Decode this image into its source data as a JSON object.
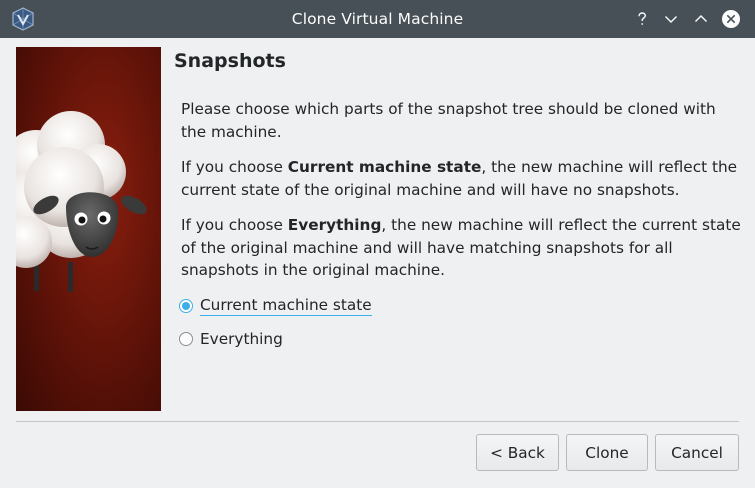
{
  "window": {
    "title": "Clone Virtual Machine",
    "controls": [
      "help-icon",
      "minimize-icon",
      "maximize-icon",
      "close-icon"
    ]
  },
  "page": {
    "title": "Snapshots",
    "paragraph1": "Please choose which parts of the snapshot tree should be cloned with the machine.",
    "paragraph2": {
      "prefix": "If you choose ",
      "bold": "Current machine state",
      "suffix": ", the new machine will reflect the current state of the original machine and will have no snapshots."
    },
    "paragraph3": {
      "prefix": "If you choose ",
      "bold": "Everything",
      "suffix": ", the new machine will reflect the current state of the original machine and will have matching snapshots for all snapshots in the original machine."
    }
  },
  "options": {
    "current": {
      "label": "Current machine state",
      "checked": true
    },
    "everything": {
      "label": "Everything",
      "checked": false
    }
  },
  "buttons": {
    "back": "< Back",
    "clone": "Clone",
    "cancel": "Cancel"
  },
  "colors": {
    "titlebar": "#475057",
    "accent": "#3daee9",
    "banner": "#6b1509"
  }
}
